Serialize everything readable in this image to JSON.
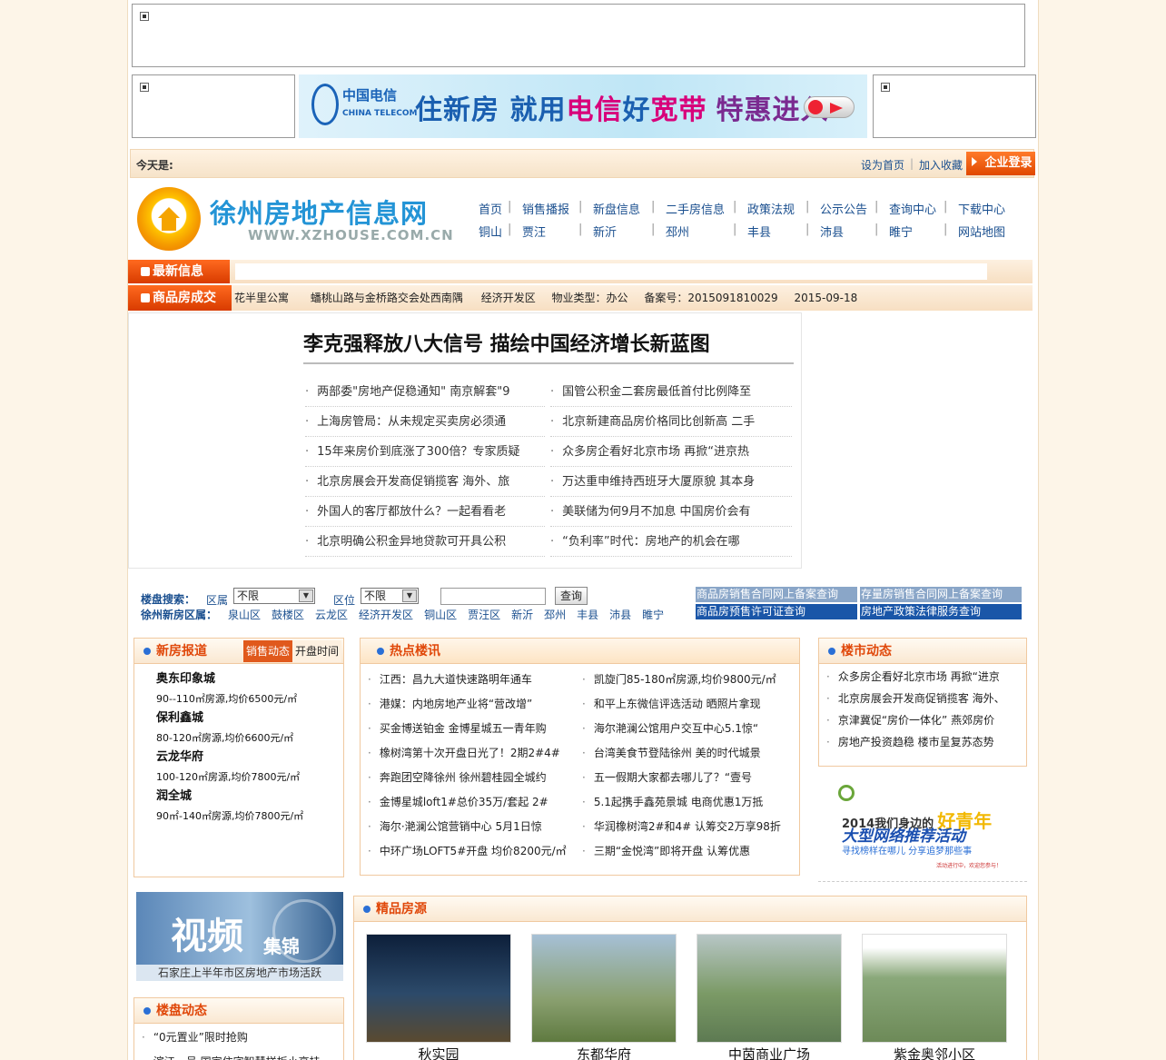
{
  "header": {
    "today_label": "今天是:",
    "set_home": "设为首页",
    "add_fav": "加入收藏",
    "login": "企业登录"
  },
  "banner": {
    "cn_brand": "中国电信",
    "en_brand": "CHINA TELECOM",
    "slogan_a": "住新房 就用",
    "slogan_b": "电信",
    "slogan_c": "好",
    "slogan_d": "宽带",
    "slogan_e": "特惠进入"
  },
  "logo": {
    "title": "徐州房地产信息网",
    "url": "WWW.XZHOUSE.COM.CN"
  },
  "nav": {
    "row1": [
      "首页",
      "销售播报",
      "新盘信息",
      "二手房信息",
      "政策法规",
      "公示公告",
      "查询中心",
      "下载中心"
    ],
    "row2": [
      "铜山",
      "贾汪",
      "新沂",
      "邳州",
      "丰县",
      "沛县",
      "睢宁",
      "网站地图"
    ]
  },
  "ticker": {
    "latest_label": "最新信息",
    "deal_label": "商品房成交",
    "deal_fields": [
      "花半里公寓",
      "蟠桃山路与金桥路交会处西南隅",
      "经济开发区",
      "物业类型：办公",
      "备案号：2015091810029",
      "2015-09-18"
    ]
  },
  "headline": {
    "title": "李克强释放八大信号 描绘中国经济增长新蓝图",
    "left": [
      "两部委\"房地产促稳通知\" 南京解套\"9",
      "上海房管局：从未规定买卖房必须通",
      "15年来房价到底涨了300倍？专家质疑",
      "北京房展会开发商促销揽客 海外、旅",
      "外国人的客厅都放什么？一起看看老",
      "北京明确公积金异地贷款可开具公积"
    ],
    "right": [
      "国管公积金二套房最低首付比例降至",
      "北京新建商品房价格同比创新高 二手",
      "众多房企看好北京市场 再掀“进京热",
      "万达重申维持西班牙大厦原貌 其本身",
      "美联储为何9月不加息 中国房价会有",
      "“负利率”时代：房地产的机会在哪"
    ]
  },
  "search": {
    "label": "楼盘搜索：",
    "district_label": "区属",
    "district_value": "不限",
    "area_label": "区位",
    "area_value": "不限",
    "button": "查询",
    "region_label": "徐州新房区属：",
    "regions": [
      "泉山区",
      "鼓楼区",
      "云龙区",
      "经济开发区",
      "铜山区",
      "贾汪区",
      "新沂",
      "邳州",
      "丰县",
      "沛县",
      "睢宁"
    ]
  },
  "queries": [
    "商品房销售合同网上备案查询",
    "存量房销售合同网上备案查询",
    "商品房预售许可证查询",
    "房地产政策法律服务查询"
  ],
  "newhouse": {
    "title": "新房报道",
    "tab_active": "销售动态",
    "tab_other": "开盘时间",
    "items": [
      {
        "name": "奥东印象城",
        "desc": "90--110㎡房源,均价6500元/㎡"
      },
      {
        "name": "保利鑫城",
        "desc": "80-120㎡房源,均价6600元/㎡"
      },
      {
        "name": "云龙华府",
        "desc": "100-120㎡房源,均价7800元/㎡"
      },
      {
        "name": "润全城",
        "desc": "90㎡-140㎡房源,均价7800元/㎡"
      }
    ]
  },
  "hot": {
    "title": "热点楼讯",
    "left": [
      "江西：昌九大道快速路明年通车",
      "港媒：内地房地产业将“营改增”",
      "买金博送铂金 金博星城五一青年购",
      "橡树湾第十次开盘日光了！2期2#4#",
      "奔跑团空降徐州 徐州碧桂园全城约",
      "金博星城loft1#总价35万/套起 2#",
      "海尔·滟澜公馆营销中心 5月1日惊",
      "中环广场LOFT5#开盘 均价8200元/㎡"
    ],
    "right": [
      "凯旋门85-180㎡房源,均价9800元/㎡",
      "和平上东微信评选活动 晒照片拿现",
      "海尔滟澜公馆用户交互中心5.1惊“",
      "台湾美食节登陆徐州 美的时代城景",
      "五一假期大家都去哪儿了？“壹号",
      "5.1起携手鑫苑景城 电商优惠1万抵",
      "华润橡树湾2#和4# 认筹交2万享98折",
      "三期“金悦湾”即将开盘 认筹优惠"
    ]
  },
  "market": {
    "title": "楼市动态",
    "items": [
      "众多房企看好北京市场 再掀“进京",
      "北京房展会开发商促销揽客 海外、",
      "京津冀促“房价一体化” 燕郊房价",
      "房地产投资趋稳 楼市呈复苏态势"
    ]
  },
  "promo": {
    "line1": "2014我们身边的",
    "line1b": "好青年",
    "line2": "大型网络推荐活动",
    "line3": "寻找榜样在哪儿 分享追梦那些事",
    "line4": "活动进行中，欢迎您参与！"
  },
  "video": {
    "big": "视频",
    "small": "集锦",
    "caption": "石家庄上半年市区房地产市场活跃"
  },
  "projnews": {
    "title": "楼盘动态",
    "items": [
      "“0元置业”限时抢购",
      "滨江一号 国家住宅智慧样板小高挂"
    ]
  },
  "fine": {
    "title": "精品房源",
    "items": [
      "秋实园",
      "东都华府",
      "中茵商业广场",
      "紫金奥邻小区"
    ]
  },
  "colors": {
    "accent": "#e0480a",
    "link": "#1a4f8f",
    "bg": "#fdf5e8"
  }
}
